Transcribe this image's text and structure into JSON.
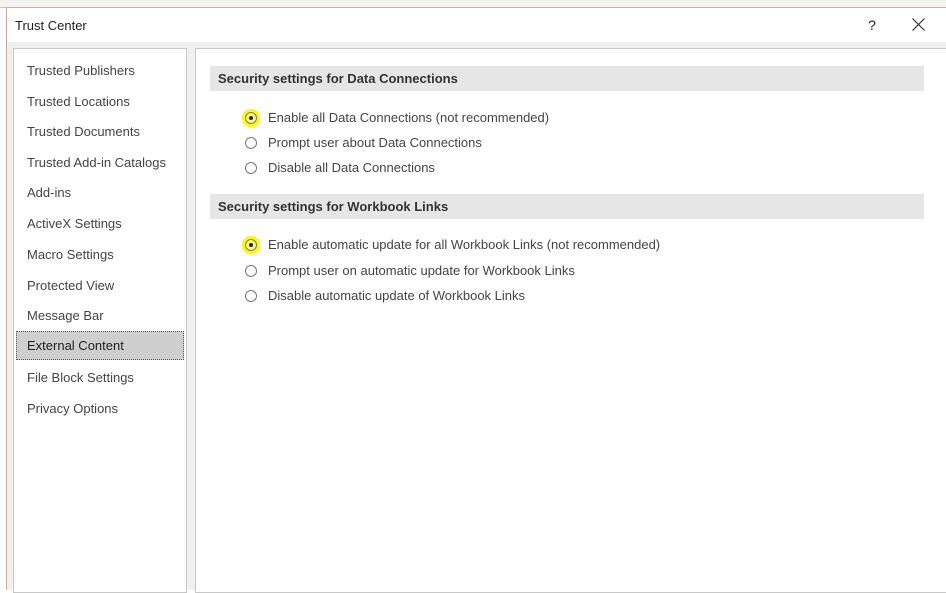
{
  "window": {
    "title": "Trust Center",
    "help_glyph": "?",
    "close_icon": "close-icon"
  },
  "sidebar": {
    "items": [
      {
        "label": "Trusted Publishers",
        "selected": false
      },
      {
        "label": "Trusted Locations",
        "selected": false
      },
      {
        "label": "Trusted Documents",
        "selected": false
      },
      {
        "label": "Trusted Add-in Catalogs",
        "selected": false
      },
      {
        "label": "Add-ins",
        "selected": false
      },
      {
        "label": "ActiveX Settings",
        "selected": false
      },
      {
        "label": "Macro Settings",
        "selected": false
      },
      {
        "label": "Protected View",
        "selected": false
      },
      {
        "label": "Message Bar",
        "selected": false
      },
      {
        "label": "External Content",
        "selected": true
      },
      {
        "label": "File Block Settings",
        "selected": false
      },
      {
        "label": "Privacy Options",
        "selected": false
      }
    ]
  },
  "data_connections": {
    "header": "Security settings for Data Connections",
    "options": [
      {
        "label": "Enable all Data Connections (not recommended)",
        "checked": true
      },
      {
        "label": "Prompt user about Data Connections",
        "checked": false
      },
      {
        "label": "Disable all Data Connections",
        "checked": false
      }
    ]
  },
  "workbook_links": {
    "header": "Security settings for Workbook Links",
    "options": [
      {
        "label": "Enable automatic update for all Workbook Links (not recommended)",
        "checked": true
      },
      {
        "label": "Prompt user on automatic update for Workbook Links",
        "checked": false
      },
      {
        "label": "Disable automatic update of Workbook Links",
        "checked": false
      }
    ]
  },
  "colors": {
    "highlight": "#ffff00",
    "selected_item_bg": "#cfcfcf",
    "section_header_bg": "#e6e6e6"
  }
}
